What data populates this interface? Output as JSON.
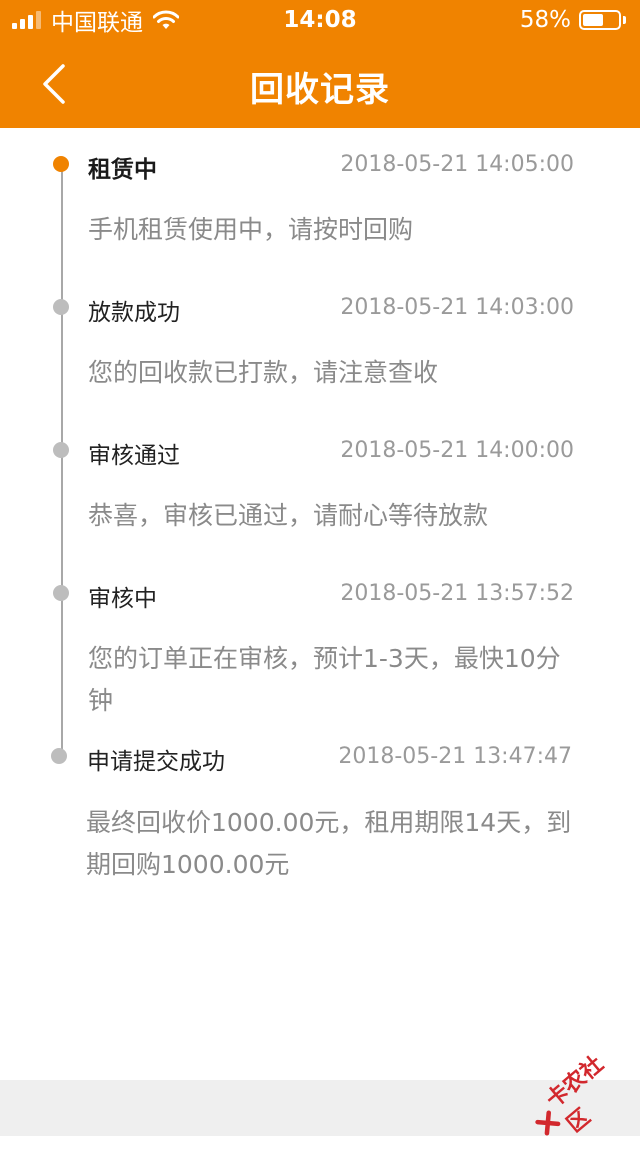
{
  "status_bar": {
    "carrier": "中国联通",
    "time": "14:08",
    "battery_percent": "58%",
    "battery_level": 0.58,
    "signal_bars_filled": 3,
    "signal_bars_total": 4
  },
  "nav": {
    "title": "回收记录",
    "back_icon": "chevron-left-icon"
  },
  "colors": {
    "accent": "#f08300",
    "timeline_line": "#a8a8a8",
    "inactive_dot": "#bdbdbd",
    "text_secondary": "#8a8a8a"
  },
  "timeline": [
    {
      "title": "租赁中",
      "time": "2018-05-21 14:05:00",
      "desc": "手机租赁使用中，请按时回购",
      "active": true
    },
    {
      "title": "放款成功",
      "time": "2018-05-21 14:03:00",
      "desc": "您的回收款已打款，请注意查收",
      "active": false
    },
    {
      "title": "审核通过",
      "time": "2018-05-21 14:00:00",
      "desc": "恭喜，审核已通过，请耐心等待放款",
      "active": false
    },
    {
      "title": "审核中",
      "time": "2018-05-21 13:57:52",
      "desc": "您的订单正在审核，预计1-3天，最快10分钟",
      "active": false
    },
    {
      "title": "申请提交成功",
      "time": "2018-05-21 13:47:47",
      "desc": "最终回收价1000.00元，租用期限14天，到期回购1000.00元",
      "active": false
    }
  ],
  "watermark": {
    "text": "卡农社区"
  }
}
